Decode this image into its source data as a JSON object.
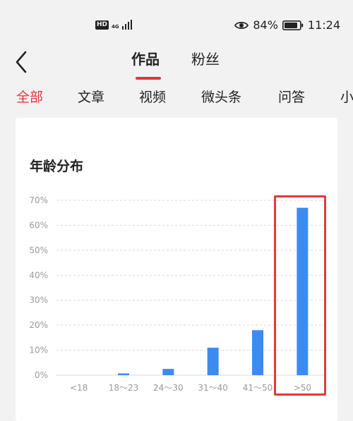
{
  "status_bar": {
    "network_badge": "HD",
    "network_type": "4G",
    "battery_percent": "84%",
    "time": "11:24"
  },
  "header": {
    "tabs": [
      {
        "label": "作品",
        "active": true
      },
      {
        "label": "粉丝",
        "active": false
      }
    ]
  },
  "category_tabs": [
    {
      "label": "全部",
      "active": true
    },
    {
      "label": "文章",
      "active": false
    },
    {
      "label": "视频",
      "active": false
    },
    {
      "label": "微头条",
      "active": false
    },
    {
      "label": "问答",
      "active": false
    },
    {
      "label": "小",
      "active": false
    }
  ],
  "colors": {
    "accent": "#e0363b",
    "bar": "#3d8bf2",
    "highlight": "#e33a3a"
  },
  "chart_data": {
    "type": "bar",
    "title": "年龄分布",
    "categories": [
      "<18",
      "18～23",
      "24～30",
      "31～40",
      "41～50",
      ">50"
    ],
    "values": [
      0,
      0.7,
      2.5,
      11,
      18,
      67
    ],
    "yticks": [
      "70%",
      "60%",
      "50%",
      "40%",
      "30%",
      "20%",
      "10%",
      "0%"
    ],
    "ylim": [
      0,
      70
    ],
    "unit": "%",
    "grid": true,
    "highlighted_category": ">50"
  }
}
